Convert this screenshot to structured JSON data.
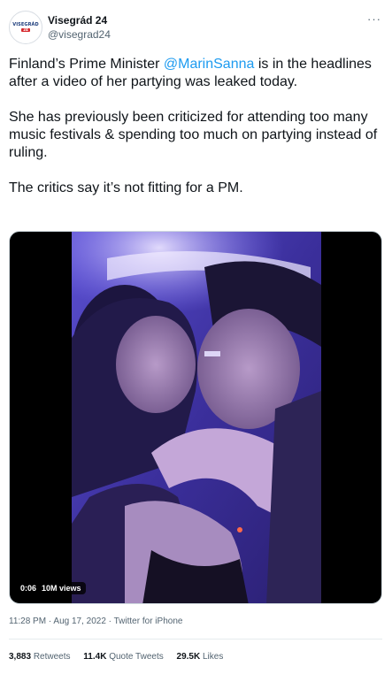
{
  "author": {
    "name": "Visegrád 24",
    "handle": "@visegrad24",
    "avatar_text": "VISEGRÁD",
    "avatar_badge": "24"
  },
  "more_label": "···",
  "tweet": {
    "para1_before": "Finland’s Prime Minister ",
    "mention": "@MarinSanna",
    "para1_after": " is in the headlines  after a video of her partying was leaked today.",
    "para2": "She has previously been criticized for attending too many music festivals & spending too much on partying instead of ruling.",
    "para3": "The critics say it’s not fitting for a PM."
  },
  "video": {
    "duration": "0:06",
    "views": "10M views"
  },
  "meta": {
    "time": "11:28 PM",
    "separator": " · ",
    "date": "Aug 17, 2022",
    "source": "Twitter for iPhone"
  },
  "stats": {
    "retweets_count": "3,883",
    "retweets_label": "Retweets",
    "quotes_count": "11.4K",
    "quotes_label": "Quote Tweets",
    "likes_count": "29.5K",
    "likes_label": "Likes"
  },
  "colors": {
    "accent": "#1d9bf0",
    "secondary_text": "#536471",
    "primary_text": "#0f1419"
  }
}
